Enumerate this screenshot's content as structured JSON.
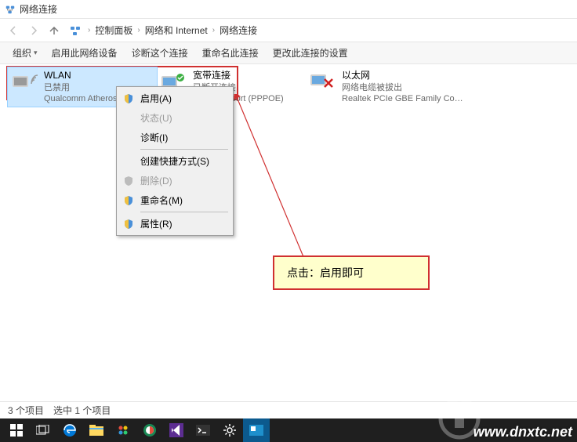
{
  "titlebar": {
    "title": "网络连接"
  },
  "breadcrumb": {
    "items": [
      "控制面板",
      "网络和 Internet",
      "网络连接"
    ]
  },
  "toolbar": {
    "organize": "组织",
    "enable": "启用此网络设备",
    "diagnose": "诊断这个连接",
    "rename": "重命名此连接",
    "change": "更改此连接的设置"
  },
  "connections": {
    "wlan": {
      "name": "WLAN",
      "status": "已禁用",
      "desc": "Qualcomm Atheros AR..."
    },
    "broadband": {
      "name": "宽带连接",
      "status": "已断开连接",
      "desc": "WAN Miniport (PPPOE)"
    },
    "ethernet": {
      "name": "以太网",
      "status": "网络电缆被拔出",
      "desc": "Realtek PCIe GBE Family Contr..."
    }
  },
  "contextmenu": {
    "enable": "启用(A)",
    "status": "状态(U)",
    "diagnose": "诊断(I)",
    "shortcut": "创建快捷方式(S)",
    "delete": "删除(D)",
    "rename": "重命名(M)",
    "properties": "属性(R)"
  },
  "annotation": {
    "text": "点击：启用即可"
  },
  "statusbar": {
    "count": "3 个项目",
    "selected": "选中 1 个项目"
  },
  "watermark": "www.dnxtc.net"
}
